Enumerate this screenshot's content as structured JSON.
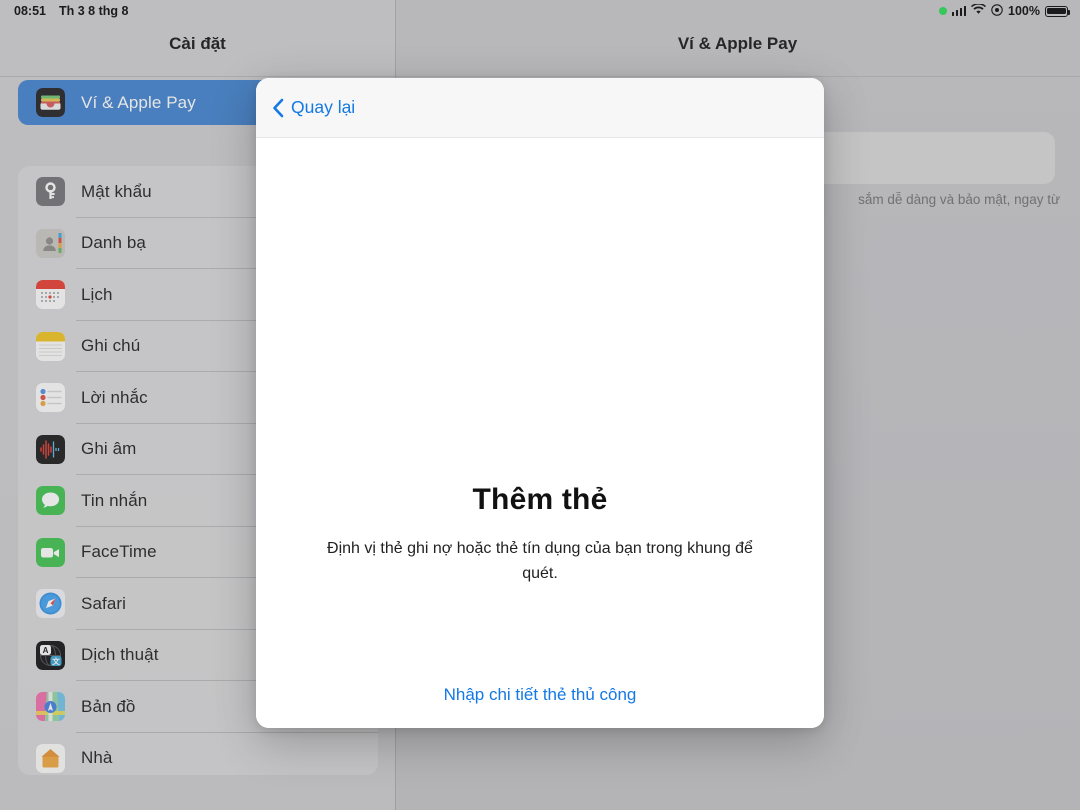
{
  "status_bar": {
    "time": "08:51",
    "date": "Th 3 8 thg 8",
    "battery_percent": "100%",
    "icons": [
      "green-recording-dot",
      "cellular-bars-icon",
      "wifi-icon",
      "screen-record-icon",
      "battery-icon"
    ]
  },
  "sidebar": {
    "title": "Cài đặt",
    "selected": {
      "label": "Ví & Apple Pay",
      "icon": "wallet-icon"
    },
    "items": [
      {
        "label": "Mật khẩu",
        "icon": "passwords-icon"
      },
      {
        "label": "Danh bạ",
        "icon": "contacts-icon"
      },
      {
        "label": "Lịch",
        "icon": "calendar-icon"
      },
      {
        "label": "Ghi chú",
        "icon": "notes-icon"
      },
      {
        "label": "Lời nhắc",
        "icon": "reminders-icon"
      },
      {
        "label": "Ghi âm",
        "icon": "voice-memos-icon"
      },
      {
        "label": "Tin nhắn",
        "icon": "messages-icon"
      },
      {
        "label": "FaceTime",
        "icon": "facetime-icon"
      },
      {
        "label": "Safari",
        "icon": "safari-icon"
      },
      {
        "label": "Dịch thuật",
        "icon": "translate-icon"
      },
      {
        "label": "Bản đồ",
        "icon": "maps-icon"
      },
      {
        "label": "Nhà",
        "icon": "home-icon"
      }
    ]
  },
  "detail": {
    "title": "Ví & Apple Pay",
    "description_fragment": "sắm dễ dàng và bảo mật, ngay từ"
  },
  "modal": {
    "back_label": "Quay lại",
    "back_icon": "chevron-left-icon",
    "title": "Thêm thẻ",
    "subtitle": "Định vị thẻ ghi nợ hoặc thẻ tín dụng của bạn trong khung để quét.",
    "manual_link": "Nhập chi tiết thẻ thủ công"
  },
  "colors": {
    "accent_blue": "#1479e4",
    "selection_blue": "#3d80ce",
    "status_green": "#35c759",
    "modal_bg": "#ffffff",
    "sidebar_bg": "#cfcfd1"
  }
}
